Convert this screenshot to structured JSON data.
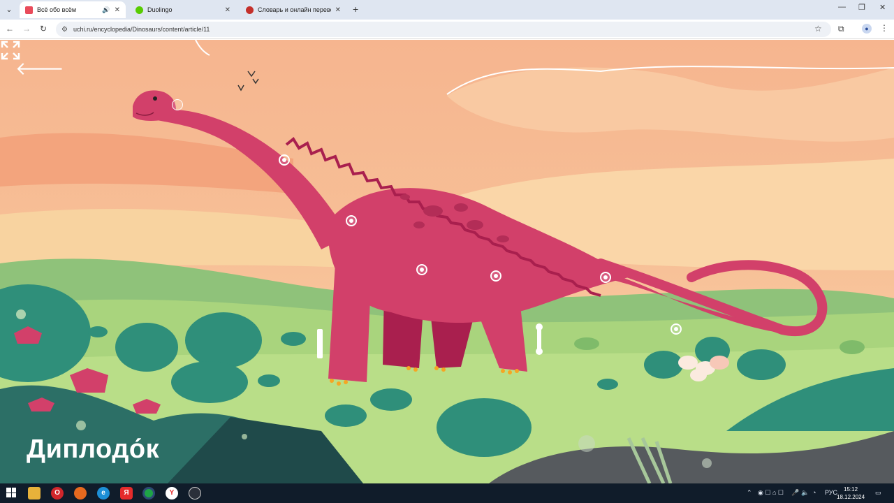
{
  "tabs": [
    {
      "title": "Всё обо всём",
      "active": true,
      "favicon_color": "#e94b5b"
    },
    {
      "title": "Duolingo",
      "active": false,
      "favicon_color": "#58cc02"
    },
    {
      "title": "Словарь и онлайн перевод на",
      "active": false,
      "favicon_color": "#c4302b"
    }
  ],
  "address_bar": {
    "url": "uchi.ru/encyclopedia/Dinosaurs/content/article/11"
  },
  "page": {
    "title": "Диплодо́к",
    "back_icon": "arrow-left-icon",
    "fullscreen_icon": "expand-icon"
  },
  "colors": {
    "dino": "#d2406a",
    "dino_dark": "#a91f4e",
    "sky_top": "#f3a884",
    "sky_bottom": "#fbd1a4",
    "grass": "#a9d47d",
    "bush": "#2f8f7a"
  },
  "taskbar": {
    "language": "РУС",
    "time": "15:12",
    "date": "18.12.2024",
    "apps": [
      "file-explorer-icon",
      "opera-icon",
      "firefox-icon",
      "edge-icon",
      "yandex-icon",
      "chrome-icon",
      "yandex-browser-icon",
      "steam-icon"
    ]
  }
}
